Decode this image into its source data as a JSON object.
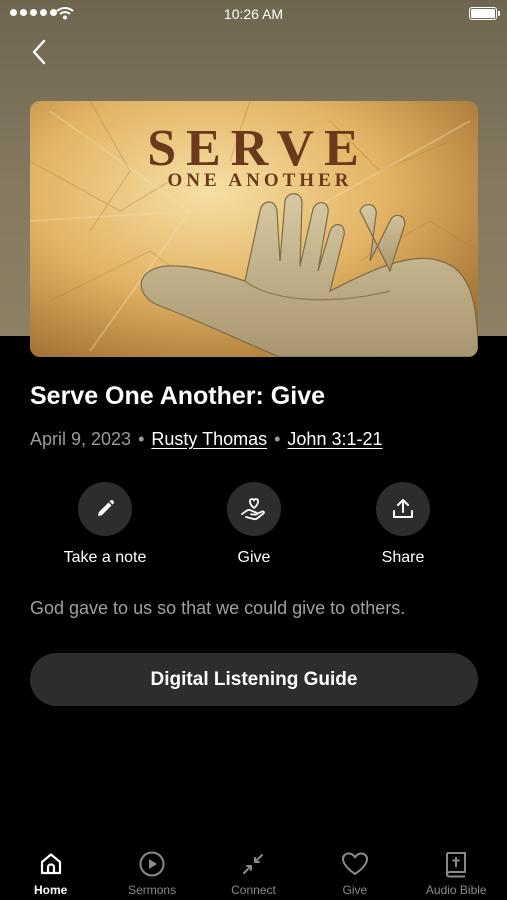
{
  "status_bar": {
    "time": "10:26 AM"
  },
  "artwork": {
    "title_big": "SERVE",
    "title_small": "ONE ANOTHER"
  },
  "sermon": {
    "title": "Serve One Another: Give",
    "date": "April 9, 2023",
    "speaker": "Rusty Thomas",
    "scripture": "John 3:1-21",
    "separator": "•",
    "description": "God gave to us so that we could give to others."
  },
  "actions": [
    {
      "label": "Take a note",
      "icon": "pencil-icon"
    },
    {
      "label": "Give",
      "icon": "hand-heart-icon"
    },
    {
      "label": "Share",
      "icon": "share-icon"
    }
  ],
  "guide_button": {
    "label": "Digital Listening Guide"
  },
  "tabs": [
    {
      "label": "Home",
      "icon": "home-icon",
      "active": true
    },
    {
      "label": "Sermons",
      "icon": "play-circle-icon",
      "active": false
    },
    {
      "label": "Connect",
      "icon": "collapse-arrows-icon",
      "active": false
    },
    {
      "label": "Give",
      "icon": "heart-icon",
      "active": false
    },
    {
      "label": "Audio Bible",
      "icon": "bible-icon",
      "active": false
    }
  ],
  "colors": {
    "header_bg": "#857a60",
    "page_bg": "#000000",
    "button_bg": "#2d2d2d",
    "artwork_text": "#6b3a1a"
  }
}
